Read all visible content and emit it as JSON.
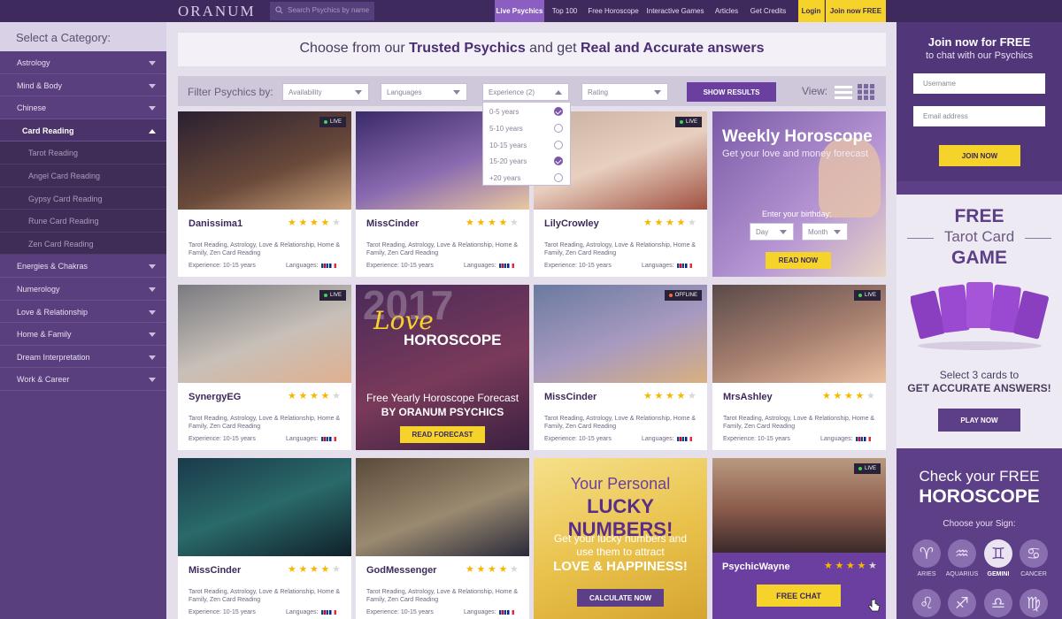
{
  "topnav": {
    "logo": "ORANUM",
    "search_placeholder": "Search Psychics by name",
    "items": [
      "Live Psychics",
      "Top 100",
      "Free Horoscope",
      "Interactive Games",
      "Articles",
      "Get Credits"
    ],
    "login": "Login",
    "join": "Join now FREE"
  },
  "sidebar": {
    "heading": "Select a Category:",
    "items": [
      "Astrology",
      "Mind & Body",
      "Chinese",
      "Card Reading",
      "Tarot Reading",
      "Angel Card Reading",
      "Gypsy Card Reading",
      "Rune Card Reading",
      "Zen Card Reading",
      "Energies & Chakras",
      "Numerology",
      "Love & Relationship",
      "Home & Family",
      "Dream Interpretation",
      "Work & Career"
    ]
  },
  "headline": {
    "pre": "Choose from our ",
    "b1": "Trusted Psychics",
    "mid": " and get ",
    "b2": "Real and Accurate answers"
  },
  "filter": {
    "label": "Filter Psychics by:",
    "availability": "Availability",
    "languages": "Languages",
    "experience": "Experience",
    "experience_count": "(2)",
    "rating": "Rating",
    "show": "SHOW RESULTS",
    "view": "View:",
    "options": [
      {
        "label": "0-5 years",
        "checked": true
      },
      {
        "label": "5-10 years",
        "checked": false
      },
      {
        "label": "10-15 years",
        "checked": false
      },
      {
        "label": "15-20 years",
        "checked": true
      },
      {
        "label": "+20 years",
        "checked": false
      }
    ]
  },
  "cards": [
    {
      "name": "Danissima1",
      "status": "LIVE",
      "rating": 4,
      "tags": "Tarot Reading, Astrology, Love & Relationship, Home & Family, Zen Card Reading",
      "experience": "Experience: 10-15 years",
      "languages": "Languages:"
    },
    {
      "name": "MissCinder",
      "status": "",
      "rating": 4,
      "tags": "Tarot Reading, Astrology, Love & Relationship, Home & Family, Zen Card Reading",
      "experience": "Experience: 10-15 years",
      "languages": "Languages:"
    },
    {
      "name": "LilyCrowley",
      "status": "LIVE",
      "rating": 4,
      "tags": "Tarot Reading, Astrology, Love & Relationship, Home & Family, Zen Card Reading",
      "experience": "Experience: 10-15 years",
      "languages": "Languages:"
    },
    {
      "name": "SynergyEG",
      "status": "LIVE",
      "rating": 4,
      "tags": "Tarot Reading, Astrology, Love & Relationship, Home & Family, Zen Card Reading",
      "experience": "Experience: 10-15 years",
      "languages": "Languages:"
    },
    {
      "name": "MissCinder",
      "status": "OFFLINE",
      "rating": 4,
      "tags": "Tarot Reading, Astrology, Love & Relationship, Home & Family, Zen Card Reading",
      "experience": "Experience: 10-15 years",
      "languages": "Languages:"
    },
    {
      "name": "MrsAshley",
      "status": "LIVE",
      "rating": 4,
      "tags": "Tarot Reading, Astrology, Love & Relationship, Home & Family, Zen Card Reading",
      "experience": "Experience: 10-15 years",
      "languages": "Languages:"
    },
    {
      "name": "MissCinder",
      "status": "",
      "rating": 4,
      "tags": "Tarot Reading, Astrology, Love & Relationship, Home & Family, Zen Card Reading",
      "experience": "Experience: 10-15 years",
      "languages": "Languages:"
    },
    {
      "name": "GodMessenger",
      "status": "",
      "rating": 4,
      "tags": "Tarot Reading, Astrology, Love & Relationship, Home & Family, Zen Card Reading",
      "experience": "Experience: 10-15 years",
      "languages": "Languages:"
    }
  ],
  "promos": {
    "weekly": {
      "title": "Weekly Horoscope",
      "sub": "Get your love and money forecast",
      "birthday": "Enter your birthday:",
      "day": "Day",
      "month": "Month",
      "btn": "READ NOW"
    },
    "love": {
      "year": "2017",
      "love": "Love",
      "horoscope": "HOROSCOPE",
      "line1": "Free Yearly Horoscope Forecast",
      "line2": "BY ORANUM PSYCHICS",
      "btn": "READ FORECAST"
    },
    "lucky": {
      "l1": "Your Personal",
      "l2": "LUCKY NUMBERS!",
      "l3": "Get your lucky numbers and",
      "l4": "use them to attract",
      "l5": "LOVE & HAPPINESS!",
      "btn": "CALCULATE NOW"
    },
    "wayne": {
      "name": "PsychicWayne",
      "status": "LIVE",
      "rating": 4,
      "btn": "FREE CHAT"
    }
  },
  "right": {
    "join": {
      "title": "Join now for FREE",
      "sub": "to chat with our Psychics",
      "username": "Username",
      "email": "Email address",
      "btn": "JOIN NOW"
    },
    "tarot": {
      "free": "FREE",
      "mid": "Tarot Card",
      "game": "GAME",
      "line1": "Select 3 cards to",
      "line2": "GET ACCURATE ANSWERS!",
      "btn": "PLAY NOW"
    },
    "horo": {
      "l1": "Check your FREE",
      "l2": "HOROSCOPE",
      "choose": "Choose your Sign:",
      "signs": [
        {
          "glyph": "♈",
          "label": "ARIES"
        },
        {
          "glyph": "♒",
          "label": "AQUARIUS"
        },
        {
          "glyph": "♊",
          "label": "GEMINI"
        },
        {
          "glyph": "♋",
          "label": "CANCER"
        },
        {
          "glyph": "♌",
          "label": ""
        },
        {
          "glyph": "♐",
          "label": ""
        },
        {
          "glyph": "♎",
          "label": ""
        },
        {
          "glyph": "♍",
          "label": ""
        }
      ]
    }
  },
  "colors": {
    "brand": "#5c3f86",
    "accent": "#f5d32a",
    "topbar": "#3f2a5e"
  }
}
